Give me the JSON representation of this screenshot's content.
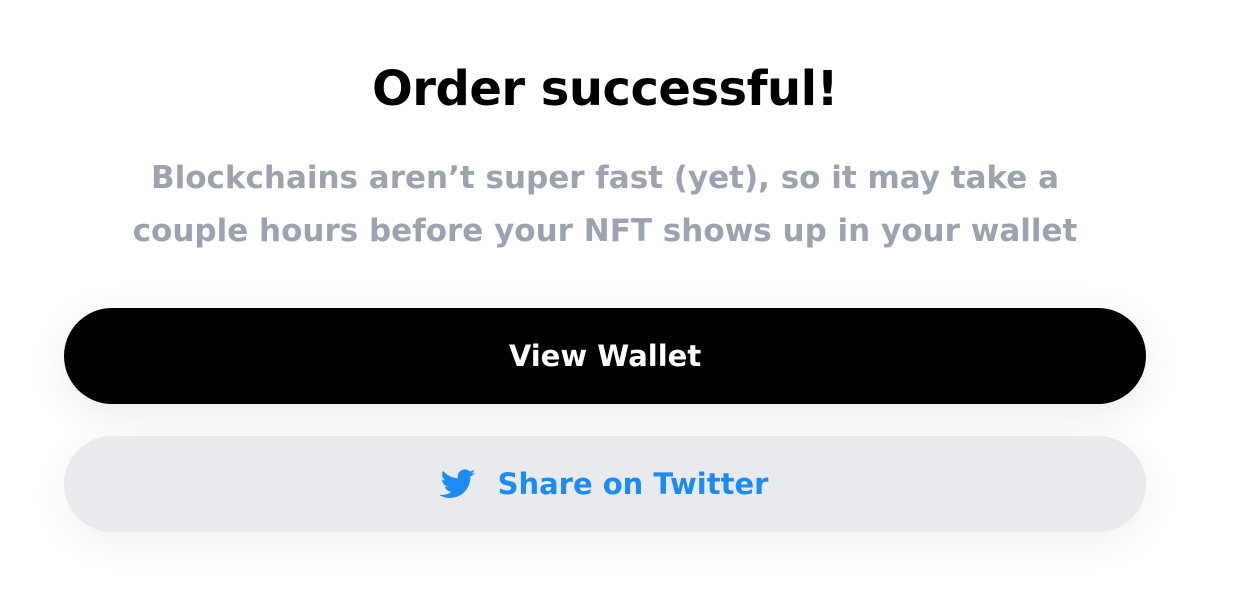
{
  "dialog": {
    "title": "Order successful!",
    "message": "Blockchains aren’t super fast (yet), so it may take a couple hours before your NFT shows up in your wallet"
  },
  "actions": {
    "view_wallet_label": "View Wallet",
    "share_twitter_label": "Share on Twitter",
    "share_twitter_icon": "twitter-icon"
  },
  "colors": {
    "title": "#000000",
    "message": "#9ca3af",
    "primary_button_bg": "#000000",
    "primary_button_text": "#ffffff",
    "secondary_button_bg": "#e9eaee",
    "secondary_button_text": "#1d8cf2",
    "twitter_blue": "#1d8cf2"
  }
}
